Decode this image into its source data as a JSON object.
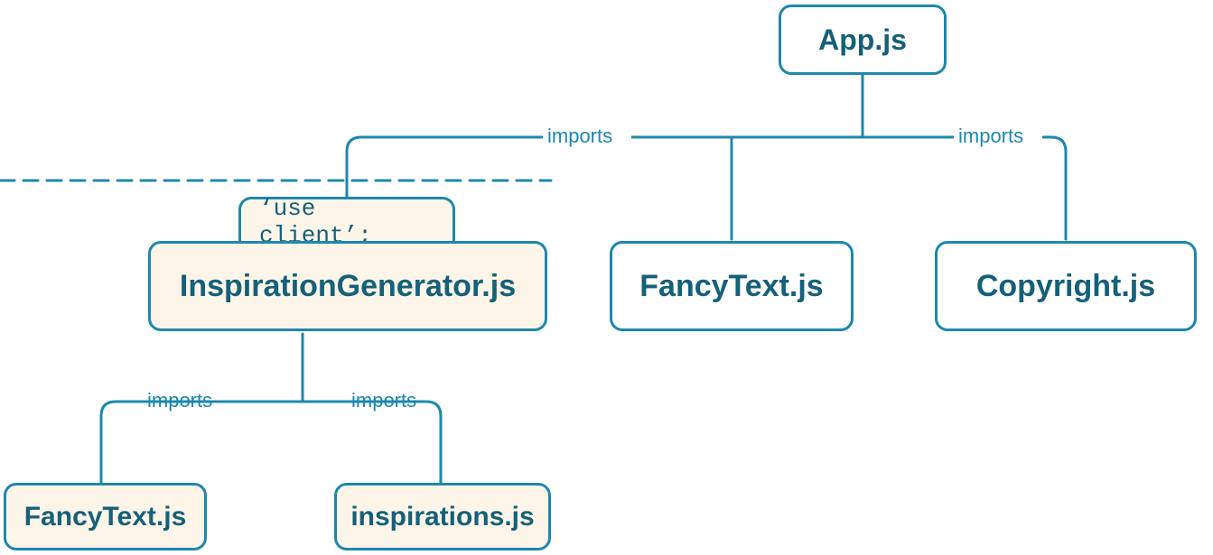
{
  "nodes": {
    "app": {
      "label": "App.js"
    },
    "inspGen": {
      "label": "InspirationGenerator.js",
      "directive": "‘use client’;"
    },
    "fancyTextTop": {
      "label": "FancyText.js"
    },
    "copyright": {
      "label": "Copyright.js"
    },
    "fancyTextBot": {
      "label": "FancyText.js"
    },
    "inspirations": {
      "label": "inspirations.js"
    }
  },
  "edges": {
    "label": "imports"
  },
  "colors": {
    "stroke": "#1d88ad",
    "text": "#15607a",
    "cream": "#fcf5e8",
    "white": "#ffffff"
  }
}
